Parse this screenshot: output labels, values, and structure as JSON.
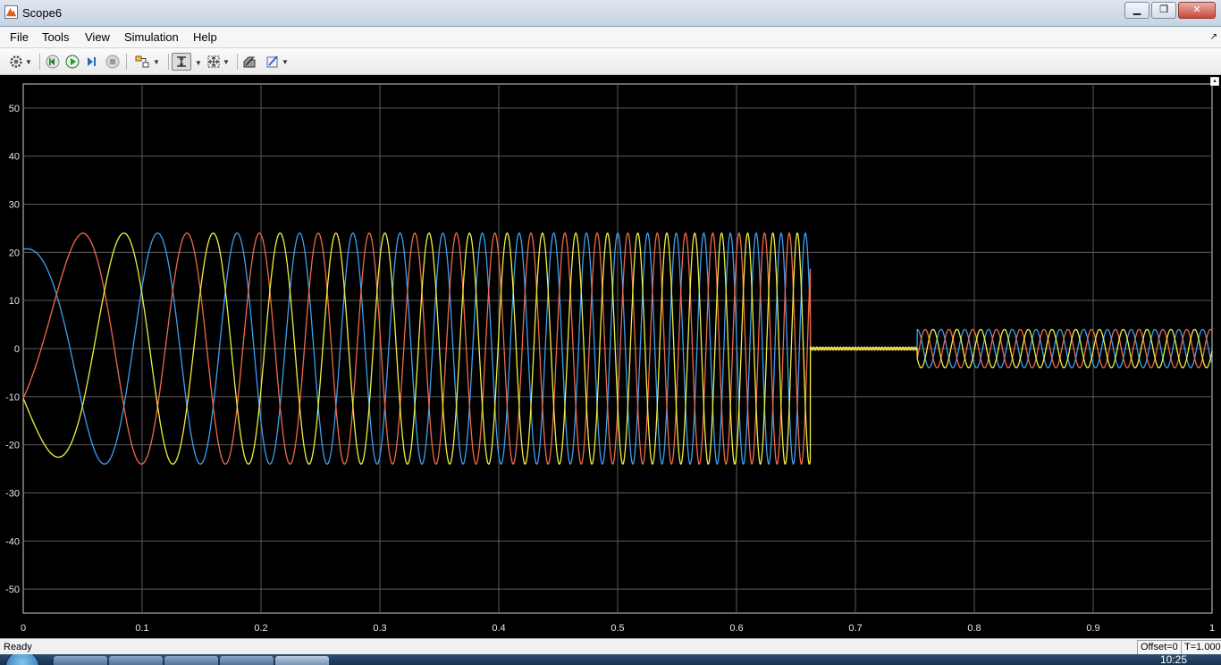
{
  "window": {
    "title": "Scope6"
  },
  "menu": [
    "File",
    "Tools",
    "View",
    "Simulation",
    "Help"
  ],
  "toolbar": {
    "parameters": "gear-icon",
    "step_back": "step-back-icon",
    "run": "run-icon",
    "step_forward": "step-forward-icon",
    "stop": "stop-icon",
    "highlight_block": "highlight-block-icon",
    "zoom": "zoom-icon",
    "autoscale": "autoscale-icon",
    "restore_layout": "restore-layout-icon",
    "style": "style-icon"
  },
  "status": {
    "text": "Ready",
    "offset": "Offset=0",
    "time": "T=1.000"
  },
  "taskbar": {
    "clock": "10:25"
  },
  "colors": {
    "background": "#000000",
    "grid": "#5a5a5a",
    "axis_text": "#e8e8e8"
  },
  "chart_data": {
    "type": "line",
    "xlim": [
      0,
      1
    ],
    "ylim": [
      -55,
      55
    ],
    "x_ticks": [
      "0",
      "0.1",
      "0.2",
      "0.3",
      "0.4",
      "0.5",
      "0.6",
      "0.7",
      "0.8",
      "0.9",
      "1"
    ],
    "y_ticks": [
      "50",
      "40",
      "30",
      "20",
      "10",
      "0",
      "-10",
      "-20",
      "-30",
      "-40",
      "-50"
    ],
    "grid": true,
    "legend": "none",
    "series": [
      {
        "color": "#3ca0f0",
        "phase_deg": 90
      },
      {
        "color": "#f06a4a",
        "phase_deg": -30
      },
      {
        "color": "#f0f040",
        "phase_deg": 210
      }
    ],
    "segments": [
      {
        "x_start": 0.0,
        "x_end": 0.662,
        "amplitude": 24,
        "freq_start": 5,
        "freq_end": 50
      },
      {
        "x_start": 0.662,
        "x_end": 0.752,
        "amplitude": 0
      },
      {
        "x_start": 0.752,
        "x_end": 1.0,
        "amplitude": 4,
        "freq_start": 50,
        "freq_end": 50
      }
    ]
  }
}
